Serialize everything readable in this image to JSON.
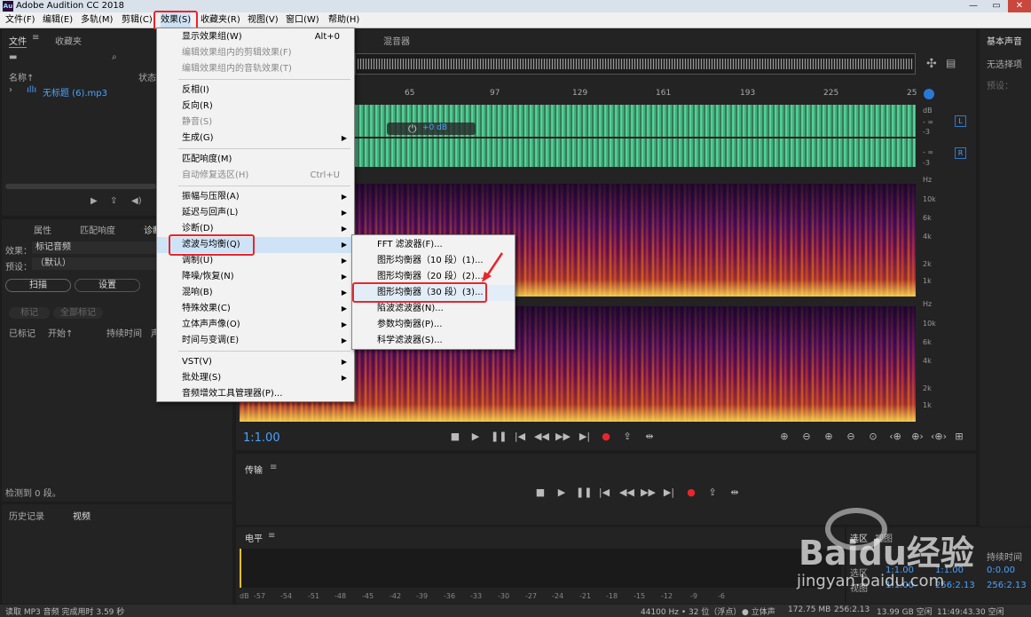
{
  "window": {
    "title": "Adobe Audition CC 2018",
    "app_icon": "Au"
  },
  "menubar": [
    "文件(F)",
    "编辑(E)",
    "多轨(M)",
    "剪辑(C)",
    "效果(S)",
    "收藏夹(R)",
    "视图(V)",
    "窗口(W)",
    "帮助(H)"
  ],
  "files_panel": {
    "tabs": [
      "文件",
      "收藏夹"
    ],
    "columns": [
      "名称↑",
      "状态"
    ],
    "file": "无标题 (6).mp3"
  },
  "props_panel": {
    "tabs": [
      "属性",
      "匹配响度",
      "诊断"
    ],
    "effect_label": "效果：",
    "effect_value": "标记音频",
    "preset_label": "预设：",
    "preset_value": "（默认）",
    "scan_button": "扫描",
    "settings_button": "设置",
    "mark_button": "标记",
    "mark_all_button": "全部标记",
    "columns": [
      "已标记",
      "开始↑",
      "持续时间",
      "声"
    ],
    "status": "检测到 0 段。"
  },
  "history_panel": {
    "tabs": [
      "历史记录",
      "视频"
    ]
  },
  "editor": {
    "tab": "混音器",
    "ruler": [
      "65",
      "97",
      "129",
      "161",
      "193",
      "225",
      "25"
    ],
    "volume": "+0 dB",
    "time": "1:1.00",
    "db_labels": [
      "dB",
      "- ∞",
      "-3",
      "- ∞",
      "-3"
    ],
    "channels": [
      "L",
      "R"
    ],
    "hz_labels": [
      "Hz",
      "10k",
      "6k",
      "4k",
      "2k",
      "1k",
      "Hz",
      "10k",
      "6k",
      "4k",
      "2k",
      "1k"
    ]
  },
  "transport": {
    "label": "传输"
  },
  "levels": {
    "label": "电平",
    "scale": [
      "dB",
      "-57",
      "-54",
      "-51",
      "-48",
      "-45",
      "-42",
      "-39",
      "-36",
      "-33",
      "-30",
      "-27",
      "-24",
      "-21",
      "-18",
      "-15",
      "-12",
      "-9",
      "-6"
    ]
  },
  "right_panel": {
    "title": "基本声音",
    "no_selection": "无选择项",
    "preset": "预设："
  },
  "selection_panel": {
    "tabs": [
      "选区",
      "视图"
    ],
    "col_duration": "持续时间",
    "row_label": "选区",
    "view_label": "视图",
    "start": "1:1.00",
    "end": "1:1.00",
    "duration": "0:0.00",
    "view_start": "1:1.00",
    "view_end": "256:2.13",
    "view_duration": "256:2.13"
  },
  "effects_menu": {
    "items": [
      {
        "label": "显示效果组(W)",
        "shortcut": "Alt+0"
      },
      {
        "label": "编辑效果组内的剪辑效果(F)",
        "disabled": true
      },
      {
        "label": "编辑效果组内的音轨效果(T)",
        "disabled": true
      },
      {
        "label": "反相(I)"
      },
      {
        "label": "反向(R)"
      },
      {
        "label": "静音(S)",
        "disabled": true
      },
      {
        "label": "生成(G)",
        "sub": true
      },
      {
        "label": "匹配响度(M)"
      },
      {
        "label": "自动修复选区(H)",
        "shortcut": "Ctrl+U",
        "disabled": true
      },
      {
        "label": "振幅与压限(A)",
        "sub": true
      },
      {
        "label": "延迟与回声(L)",
        "sub": true
      },
      {
        "label": "诊断(D)",
        "sub": true
      },
      {
        "label": "滤波与均衡(Q)",
        "sub": true
      },
      {
        "label": "调制(U)",
        "sub": true
      },
      {
        "label": "降噪/恢复(N)",
        "sub": true
      },
      {
        "label": "混响(B)",
        "sub": true
      },
      {
        "label": "特殊效果(C)",
        "sub": true
      },
      {
        "label": "立体声声像(O)",
        "sub": true
      },
      {
        "label": "时间与变调(E)",
        "sub": true
      },
      {
        "label": "VST(V)",
        "sub": true
      },
      {
        "label": "批处理(S)",
        "sub": true
      },
      {
        "label": "音频增效工具管理器(P)..."
      }
    ]
  },
  "filter_submenu": [
    "FFT 滤波器(F)...",
    "图形均衡器（10 段）(1)...",
    "图形均衡器（20 段）(2)...",
    "图形均衡器（30 段）(3)...",
    "陷波滤波器(N)...",
    "参数均衡器(P)...",
    "科学滤波器(S)..."
  ],
  "statusbar": {
    "left": "读取 MP3 音频 完成用时 3.59 秒",
    "right": [
      "44100 Hz • 32 位（浮点）",
      "● 立体声",
      "172.75 MB",
      "256:2.13",
      "13.99 GB 空闲",
      "11:49:43.30 空闲"
    ]
  },
  "watermark": {
    "brand": "Baidu经验",
    "url": "jingyan.baidu.com"
  },
  "colors": {
    "highlight": "#e8262c",
    "wave": "#58d69a",
    "time": "#4aa3ff"
  }
}
